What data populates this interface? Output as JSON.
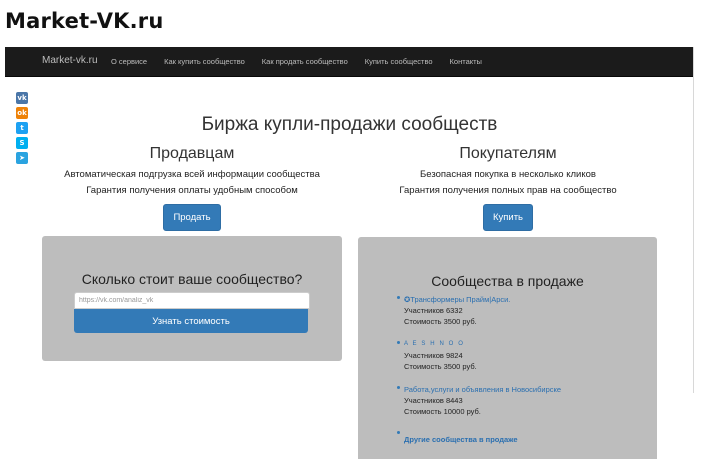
{
  "logo": "Market-VK.ru",
  "navbar": {
    "brand": "Market-vk.ru",
    "links": [
      "О сервисе",
      "Как купить сообщество",
      "Как продать сообщество",
      "Купить сообщество",
      "Контакты"
    ]
  },
  "share": {
    "buttons": [
      {
        "icon": "vk-icon",
        "glyph": "vk",
        "color": "#4a76a8"
      },
      {
        "icon": "odnoklassniki-icon",
        "glyph": "ok",
        "color": "#ee8208"
      },
      {
        "icon": "twitter-icon",
        "glyph": "t",
        "color": "#1da1f2"
      },
      {
        "icon": "skype-icon",
        "glyph": "S",
        "color": "#00aff0"
      },
      {
        "icon": "telegram-icon",
        "glyph": "➤",
        "color": "#2aa3e0"
      }
    ]
  },
  "main_title": "Биржа купли-продажи сообществ",
  "sellers": {
    "heading": "Продавцам",
    "lines": [
      "Автоматическая подгрузка всей информации сообщества",
      "Гарантия получения оплаты удобным способом"
    ],
    "button": "Продать"
  },
  "buyers": {
    "heading": "Покупателям",
    "lines": [
      "Безопасная покупка в несколько кликов",
      "Гарантия получения полных прав на сообщество"
    ],
    "button": "Купить"
  },
  "price_panel": {
    "title": "Сколько стоит ваше сообщество?",
    "input_placeholder": "https://vk.com/analiz_vk",
    "button": "Узнать стоимость"
  },
  "sale_panel": {
    "title": "Сообщества в продаже",
    "items": [
      {
        "name": "✪Трансформеры Прайм|Арси.",
        "members": "Участников 6332",
        "price": "Стоимость 3500 руб."
      },
      {
        "name": "A E S H N O O",
        "members": "Участников 9824",
        "price": "Стоимость 3500 руб."
      },
      {
        "name": "Работа,услуги и объявления в Новосибирске",
        "members": "Участников 8443",
        "price": "Стоимость 10000 руб."
      }
    ],
    "more_link": "Другие сообщества в продаже"
  }
}
